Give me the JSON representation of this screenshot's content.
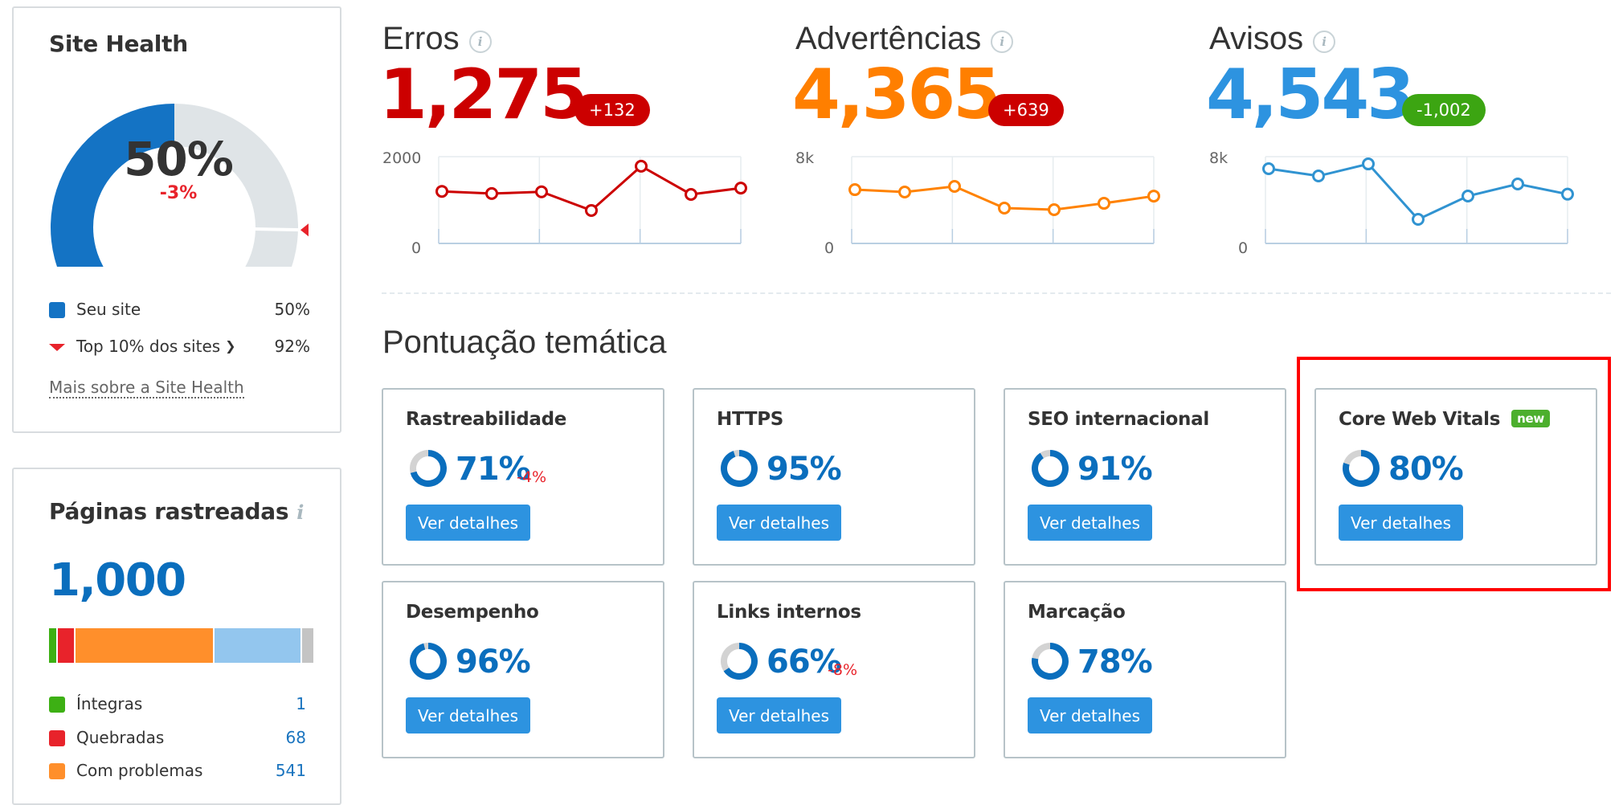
{
  "site_health": {
    "title": "Site Health",
    "value_pct": 50,
    "value_label": "50%",
    "delta_label": "-3%",
    "top10_pct": 92,
    "legend": [
      {
        "label": "Seu site",
        "value": "50%",
        "color": "#1473c4",
        "marker": "square"
      },
      {
        "label": "Top 10% dos sites",
        "value": "92%",
        "color": "#e8232b",
        "marker": "triangle",
        "dropdown_icon": "chevron-down-icon"
      }
    ],
    "more_link": "Mais sobre a Site Health",
    "colors": {
      "fill": "#1473c4",
      "track": "#dfe4e7",
      "marker": "#e8232b"
    }
  },
  "pages": {
    "title": "Páginas rastreadas",
    "info_icon": "i",
    "total": "1,000",
    "segments": [
      {
        "label": "Íntegras",
        "value": 1,
        "color": "#3db014"
      },
      {
        "label": "Quebradas",
        "value": 68,
        "color": "#e8232b"
      },
      {
        "label": "Com problemas",
        "value": 541,
        "color": "#ff8f2b"
      },
      {
        "label": "",
        "value": 340,
        "color": "#93c6ee"
      },
      {
        "label": "",
        "value": 50,
        "color": "#c4c4c4"
      }
    ],
    "legend": [
      {
        "label": "Íntegras",
        "value": "1",
        "color": "#3db014"
      },
      {
        "label": "Quebradas",
        "value": "68",
        "color": "#e8232b"
      },
      {
        "label": "Com problemas",
        "value": "541",
        "color": "#ff8f2b"
      }
    ]
  },
  "metrics": [
    {
      "title": "Erros",
      "value": "1,275",
      "color": "#cc0000",
      "badge": "+132",
      "badge_color": "#cc0000"
    },
    {
      "title": "Advertências",
      "value": "4,365",
      "color": "#ff7f00",
      "badge": "+639",
      "badge_color": "#cc0000"
    },
    {
      "title": "Avisos",
      "value": "4,543",
      "color": "#2d93e0",
      "badge": "-1,002",
      "badge_color": "#3ca512"
    }
  ],
  "chart_data": [
    {
      "type": "line",
      "title": "Erros",
      "y_ticks": [
        "2000",
        "0"
      ],
      "ylim": [
        0,
        2000
      ],
      "grid": true,
      "series": [
        {
          "name": "Erros",
          "color": "#cc0000",
          "values": [
            1200,
            1150,
            1190,
            760,
            1780,
            1130,
            1275
          ]
        }
      ]
    },
    {
      "type": "line",
      "title": "Advertências",
      "y_ticks": [
        "8k",
        "0"
      ],
      "ylim": [
        0,
        8000
      ],
      "grid": true,
      "series": [
        {
          "name": "Advertências",
          "color": "#ff8200",
          "values": [
            4960,
            4740,
            5260,
            3260,
            3110,
            3700,
            4365
          ]
        }
      ]
    },
    {
      "type": "line",
      "title": "Avisos",
      "y_ticks": [
        "8k",
        "0"
      ],
      "ylim": [
        0,
        8000
      ],
      "grid": true,
      "series": [
        {
          "name": "Avisos",
          "color": "#3093d1",
          "values": [
            6890,
            6220,
            7330,
            2220,
            4370,
            5480,
            4543
          ]
        }
      ]
    }
  ],
  "thematic": {
    "title": "Pontuação temática",
    "button_label": "Ver detalhes",
    "cards": [
      {
        "title": "Rastreabilidade",
        "value": 71,
        "value_label": "71%",
        "delta": "-4%"
      },
      {
        "title": "HTTPS",
        "value": 95,
        "value_label": "95%"
      },
      {
        "title": "SEO internacional",
        "value": 91,
        "value_label": "91%"
      },
      {
        "title": "Core Web Vitals",
        "value": 80,
        "value_label": "80%",
        "badge": "new",
        "highlighted": true
      },
      {
        "title": "Desempenho",
        "value": 96,
        "value_label": "96%"
      },
      {
        "title": "Links internos",
        "value": 66,
        "value_label": "66%",
        "delta": "-8%"
      },
      {
        "title": "Marcação",
        "value": 78,
        "value_label": "78%"
      }
    ],
    "colors": {
      "fill": "#0a6ebd",
      "track": "#d3d3d3"
    }
  }
}
